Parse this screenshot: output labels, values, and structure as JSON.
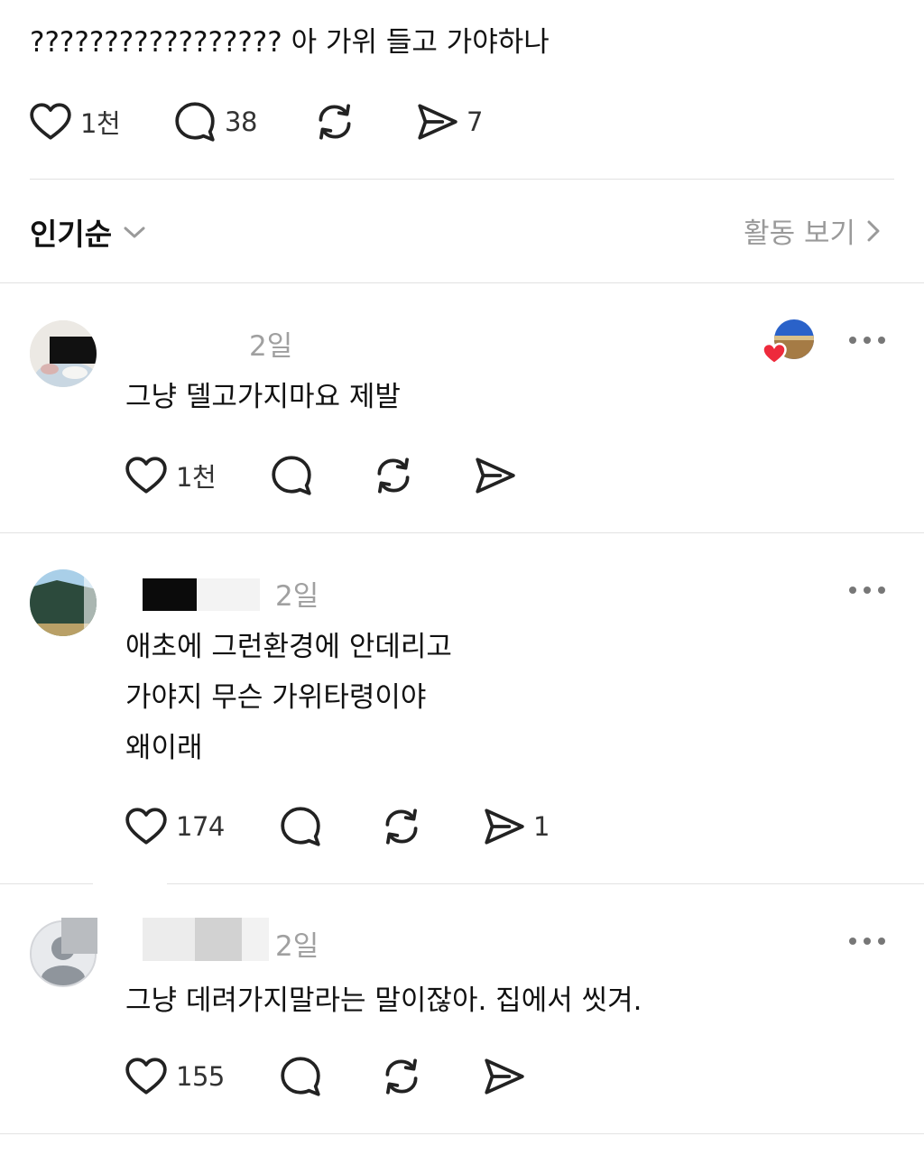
{
  "post": {
    "text": "????????????????? 아 가위 들고 가야하나",
    "likes": "1천",
    "replies": "38",
    "shares": "7"
  },
  "sort": {
    "label": "인기순",
    "activity_label": "활동 보기"
  },
  "comments": [
    {
      "time": "2일",
      "lines": [
        "그냥 델고가지마요 제발"
      ],
      "likes": "1천",
      "shares": ""
    },
    {
      "time": "2일",
      "lines": [
        "애초에 그런환경에 안데리고",
        "가야지 무슨 가위타령이야",
        "왜이래"
      ],
      "likes": "174",
      "shares": "1"
    },
    {
      "time": "2일",
      "lines": [
        "그냥 데려가지말라는 말이잖아.  집에서 씻겨."
      ],
      "likes": "155",
      "shares": ""
    }
  ],
  "icons": {
    "like": "heart-icon",
    "reply": "comment-bubble-icon",
    "repost": "repost-icon",
    "share": "send-icon",
    "more": "more-dots-icon",
    "sort_chevron": "chevron-down-icon",
    "activity_chevron": "chevron-right-icon"
  },
  "colors": {
    "text": "#111111",
    "muted": "#9a9a9a",
    "divider": "#e2e2e2",
    "liked_heart": "#ee2a3c"
  }
}
